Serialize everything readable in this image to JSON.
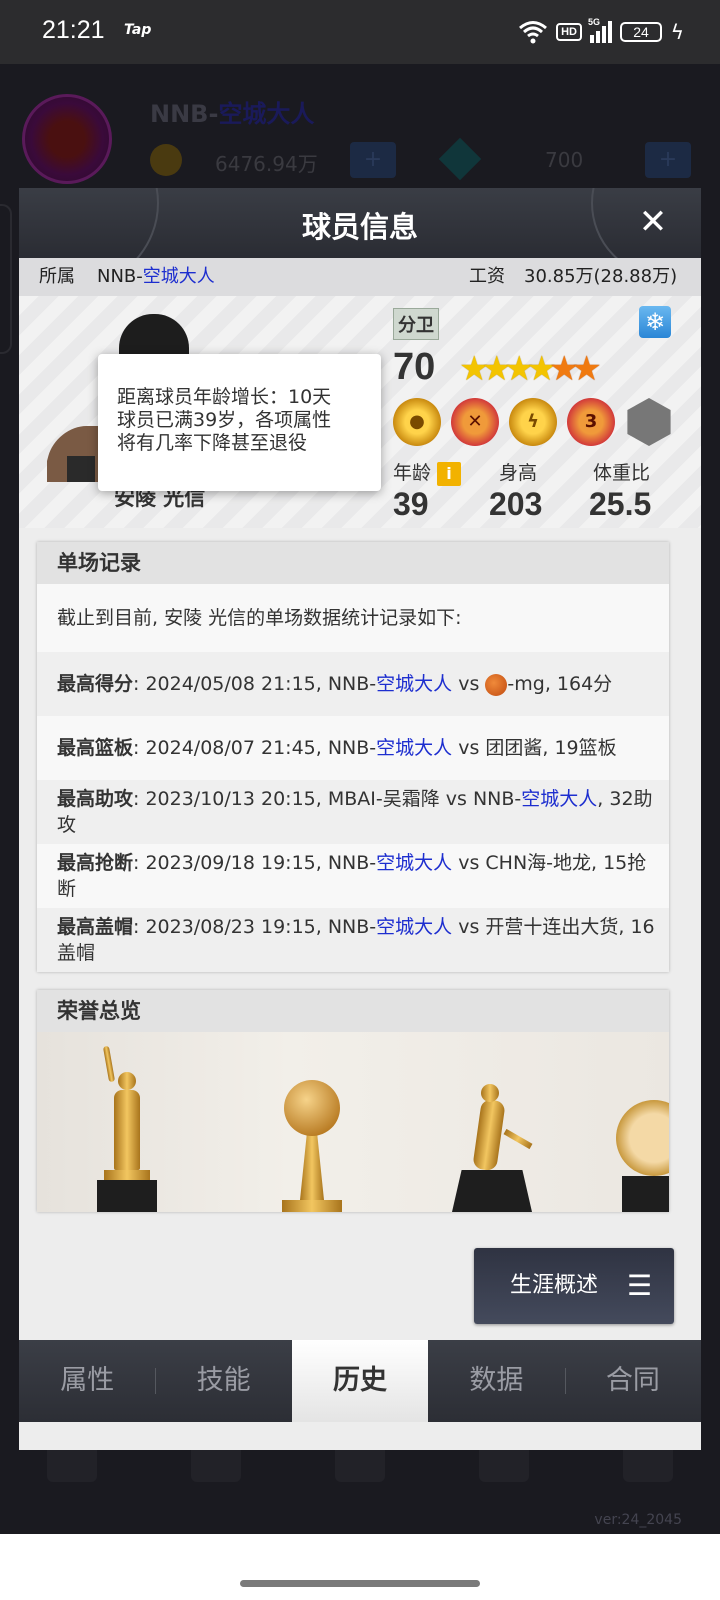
{
  "status_bar": {
    "time": "21:21",
    "app": "Tap",
    "hd": "HD",
    "network": "5G",
    "battery": "24"
  },
  "background_app": {
    "team_prefix": "NNB-",
    "team_name": "空城大人",
    "money": "6476.94万",
    "gems": "700",
    "plus": "+",
    "version": "ver:24_2045"
  },
  "modal": {
    "title": "球员信息",
    "close": "✕",
    "info": {
      "team_label": "所属",
      "team_prefix": "NNB-",
      "team_name": "空城大人",
      "salary_label": "工资",
      "salary_value": "30.85万(28.88万)"
    },
    "player": {
      "name": "安陵 光信",
      "position": "分卫",
      "rating": "70",
      "stars_yellow": 4,
      "stars_orange": 2,
      "age_label": "年龄",
      "age": "39",
      "height_label": "身高",
      "height": "203",
      "bmi_label": "体重比",
      "bmi": "25.5",
      "info_icon": "i",
      "medal_3": "3"
    },
    "tooltip": {
      "line1": "距离球员年龄增长：10天",
      "line2": "球员已满39岁，各项属性",
      "line3": "将有几率下降甚至退役"
    },
    "records": {
      "title": "单场记录",
      "intro": "截止到目前, 安陵 光信的单场数据统计记录如下:",
      "rows": [
        {
          "label": "最高得分",
          "pre": ": 2024/05/08 21:15, NNB-",
          "team": "空城大人",
          "post_a": " vs ",
          "post_b": "-mg, 164分"
        },
        {
          "label": "最高篮板",
          "pre": ": 2024/08/07 21:45, NNB-",
          "team": "空城大人",
          "post": " vs 团团酱, 19篮板"
        },
        {
          "label": "最高助攻",
          "pre": ": 2023/10/13 20:15, MBAI-吴霜降 vs NNB-",
          "team": "空城大人",
          "post": ", 32助攻"
        },
        {
          "label": "最高抢断",
          "pre": ": 2023/09/18 19:15, NNB-",
          "team": "空城大人",
          "post": " vs CHN海-地龙, 15抢断"
        },
        {
          "label": "最高盖帽",
          "pre": ": 2023/08/23 19:15, NNB-",
          "team": "空城大人",
          "post": " vs 开营十连出大货, 16盖帽"
        }
      ]
    },
    "honors": {
      "title": "荣誉总览"
    },
    "career_button": "生涯概述",
    "menu_icon": "☰",
    "tabs": [
      "属性",
      "技能",
      "历史",
      "数据",
      "合同"
    ],
    "active_tab": "历史"
  },
  "colors": {
    "link_blue": "#1d2ecf",
    "gold": "#f3c400",
    "orange_star": "#f07a10"
  }
}
